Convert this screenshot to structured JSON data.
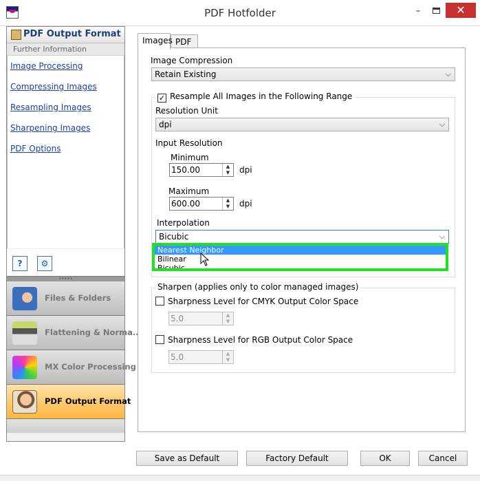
{
  "window": {
    "title": "PDF Hotfolder",
    "minimize_glyph": "–",
    "close_glyph": "✕"
  },
  "left_panel": {
    "title": "PDF Output Format",
    "subtitle": "Further Information",
    "links": [
      {
        "label": "Image Processing"
      },
      {
        "label": "Compressing Images"
      },
      {
        "label": "Resampling Images"
      },
      {
        "label": "Sharpening Images"
      },
      {
        "label": "PDF Options"
      }
    ],
    "help_glyph": "?",
    "settings_glyph": "⚙",
    "grip": "•••••"
  },
  "nav": [
    {
      "label": "Files & Folders",
      "icon": "folder-icon",
      "active": false
    },
    {
      "label": "Flattening & Norma...",
      "icon": "printer-icon",
      "active": false
    },
    {
      "label": "MX Color Processing",
      "icon": "color-cube-icon",
      "active": false
    },
    {
      "label": "PDF Output Format",
      "icon": "document-person-icon",
      "active": true
    }
  ],
  "tabs": [
    {
      "label": "Images",
      "active": true
    },
    {
      "label": "PDF",
      "active": false
    }
  ],
  "images_tab": {
    "compression_label": "Image Compression",
    "compression_value": "Retain Existing",
    "resample_checked": true,
    "resample_label": "Resample All Images in the Following Range",
    "resolution_unit_label": "Resolution Unit",
    "resolution_unit_value": "dpi",
    "input_resolution_label": "Input Resolution",
    "minimum_label": "Minimum",
    "minimum_value": "150.00",
    "minimum_unit": "dpi",
    "maximum_label": "Maximum",
    "maximum_value": "600.00",
    "maximum_unit": "dpi",
    "interpolation_label": "Interpolation",
    "interpolation_value": "Bicubic",
    "interpolation_options": [
      "Nearest Neighbor",
      "Bilinear",
      "Bicubic"
    ],
    "interpolation_highlighted": "Nearest Neighbor",
    "sharpen_group_label": "Sharpen (applies only to color managed images)",
    "sharpen_cmyk_label": "Sharpness Level for CMYK Output Color Space",
    "sharpen_cmyk_checked": false,
    "sharpen_cmyk_value": "5.0",
    "sharpen_rgb_label": "Sharpness Level for RGB Output Color Space",
    "sharpen_rgb_checked": false,
    "sharpen_rgb_value": "5.0"
  },
  "buttons": {
    "save_default": "Save as Default",
    "factory_default": "Factory Default",
    "ok": "OK",
    "cancel": "Cancel"
  },
  "colors": {
    "active_nav": "#ffb63d",
    "dropdown_highlight": "#3399ff",
    "annotation_border": "#22e022",
    "close_button": "#c7312f"
  }
}
